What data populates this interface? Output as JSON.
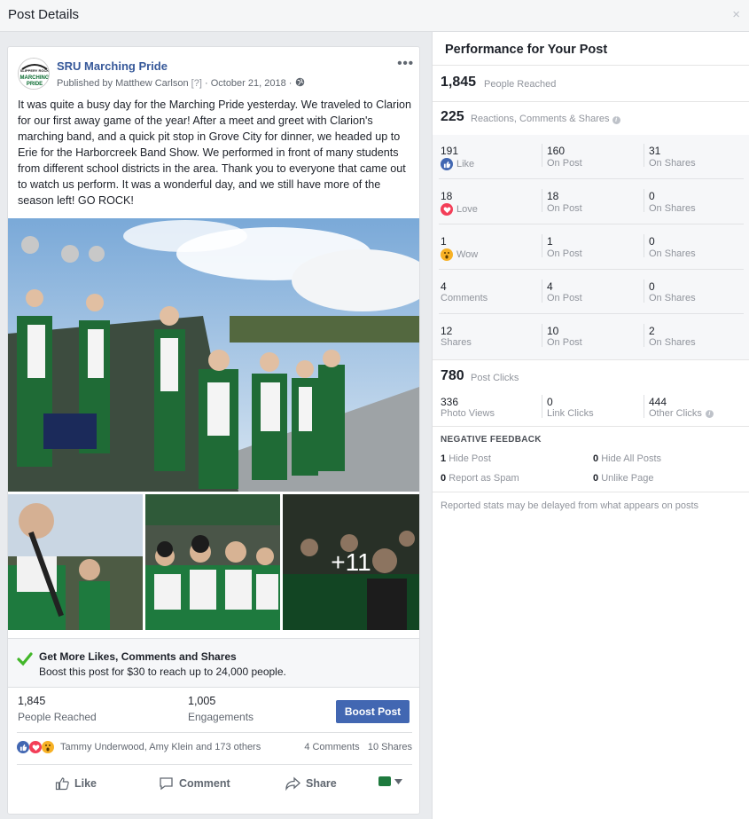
{
  "modal": {
    "title": "Post Details",
    "close_glyph": "×"
  },
  "post": {
    "page_name": "SRU Marching Pride",
    "logo_text": [
      "SLIPPERY ROCK",
      "MARCHING",
      "PRIDE"
    ],
    "publisher_prefix": "Published by",
    "publisher": "Matthew Carlson",
    "publisher_badge": "[?]",
    "date": "October 21, 2018",
    "more_glyph": "•••",
    "text": "It was quite a busy day for the Marching Pride yesterday. We traveled to Clarion for our first away game of the year! After a meet and greet with Clarion's marching band, and a quick pit stop in Grove City for dinner, we headed up to Erie for the Harborcreek Band Show. We performed in front of many students from different school districts in the area. Thank you to everyone that came out to watch us perform. It was a wonderful day, and we still have more of the season left! GO ROCK!",
    "more_photos": "+11",
    "boost": {
      "title": "Get More Likes, Comments and Shares",
      "subtitle": "Boost this post for $30 to reach up to 24,000 people."
    },
    "stats": {
      "reach_value": "1,845",
      "reach_label": "People Reached",
      "eng_value": "1,005",
      "eng_label": "Engagements",
      "boost_button": "Boost Post"
    },
    "reactions": {
      "names": "Tammy Underwood, Amy Klein and 173 others",
      "comments": "4 Comments",
      "shares": "10 Shares"
    },
    "actions": {
      "like": "Like",
      "comment": "Comment",
      "share": "Share"
    }
  },
  "performance": {
    "title": "Performance for Your Post",
    "reached_value": "1,845",
    "reached_label": "People Reached",
    "engagement_value": "225",
    "engagement_label": "Reactions, Comments & Shares",
    "rows": [
      {
        "total": "191",
        "label": "Like",
        "on_post": "160",
        "on_post_label": "On Post",
        "on_shares": "31",
        "on_shares_label": "On Shares"
      },
      {
        "total": "18",
        "label": "Love",
        "on_post": "18",
        "on_post_label": "On Post",
        "on_shares": "0",
        "on_shares_label": "On Shares"
      },
      {
        "total": "1",
        "label": "Wow",
        "on_post": "1",
        "on_post_label": "On Post",
        "on_shares": "0",
        "on_shares_label": "On Shares"
      },
      {
        "total": "4",
        "label": "Comments",
        "on_post": "4",
        "on_post_label": "On Post",
        "on_shares": "0",
        "on_shares_label": "On Shares"
      },
      {
        "total": "12",
        "label": "Shares",
        "on_post": "10",
        "on_post_label": "On Post",
        "on_shares": "2",
        "on_shares_label": "On Shares"
      }
    ],
    "clicks_value": "780",
    "clicks_label": "Post Clicks",
    "clicks": [
      {
        "value": "336",
        "label": "Photo Views"
      },
      {
        "value": "0",
        "label": "Link Clicks"
      },
      {
        "value": "444",
        "label": "Other Clicks"
      }
    ],
    "negative_title": "NEGATIVE FEEDBACK",
    "negative": [
      {
        "value": "1",
        "label": "Hide Post"
      },
      {
        "value": "0",
        "label": "Hide All Posts"
      },
      {
        "value": "0",
        "label": "Report as Spam"
      },
      {
        "value": "0",
        "label": "Unlike Page"
      }
    ],
    "footnote": "Reported stats may be delayed from what appears on posts"
  },
  "colors": {
    "link": "#365899",
    "button": "#4267b2",
    "like": "#4267b2",
    "love": "#f33e58",
    "wow": "#f7b125",
    "check": "#42b72a"
  },
  "icons": [
    "close-icon",
    "globe-icon",
    "info-icon",
    "like-icon",
    "love-icon",
    "wow-icon",
    "check-icon",
    "comment-icon",
    "share-icon",
    "caret-down-icon"
  ]
}
